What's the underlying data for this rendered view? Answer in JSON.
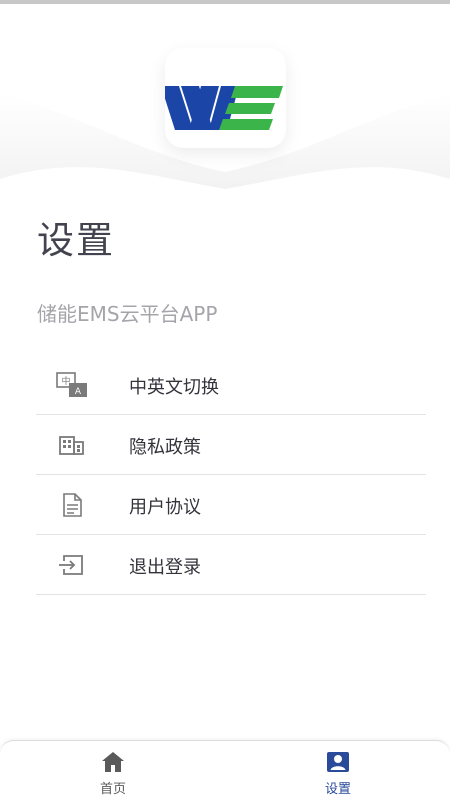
{
  "colors": {
    "logo_blue": "#1b46a8",
    "logo_green": "#3bb549",
    "title": "#43434f",
    "subtitle": "#a4a4ab",
    "tab_active": "#2a4a9a",
    "tab_inactive": "#5a5a5a"
  },
  "page": {
    "title": "设置",
    "subtitle": "储能EMS云平台APP"
  },
  "menu": {
    "items": [
      {
        "label": "中英文切换",
        "icon": "language-switch-icon"
      },
      {
        "label": "隐私政策",
        "icon": "building-icon"
      },
      {
        "label": "用户协议",
        "icon": "document-icon"
      },
      {
        "label": "退出登录",
        "icon": "logout-icon"
      }
    ]
  },
  "tabbar": {
    "tabs": [
      {
        "label": "首页",
        "icon": "home-icon",
        "active": false
      },
      {
        "label": "设置",
        "icon": "account-box-icon",
        "active": true
      }
    ]
  }
}
